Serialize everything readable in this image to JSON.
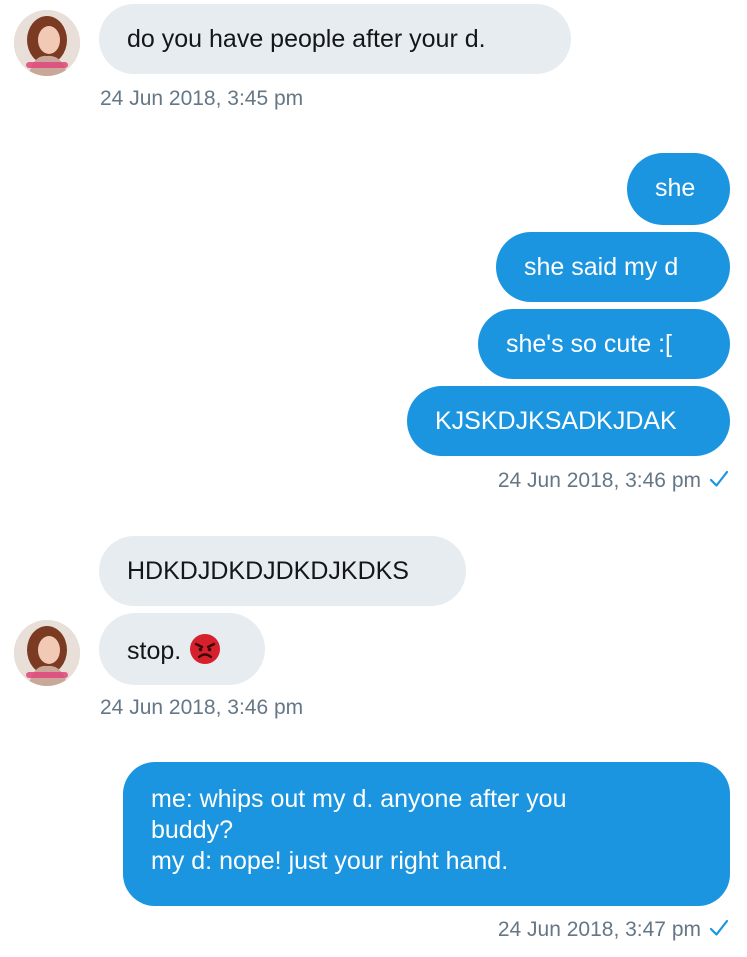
{
  "conversation": {
    "messages": [
      {
        "text": "do you have people after your d."
      },
      {
        "text": "she"
      },
      {
        "text": "she said my d"
      },
      {
        "text": "she's so cute :["
      },
      {
        "text": "KJSKDJKSADKJDAK"
      },
      {
        "text": "HDKDJDKDJDKDJKDKS"
      },
      {
        "text": "stop.",
        "emoji": "angry-face-icon"
      },
      {
        "lines": [
          "me: whips out my d. anyone after you",
          "buddy?",
          "my d: nope! just your right hand."
        ]
      }
    ],
    "timestamps": [
      "24 Jun 2018, 3:45 pm",
      "24 Jun 2018, 3:46 pm",
      "24 Jun 2018, 3:46 pm",
      "24 Jun 2018, 3:47 pm"
    ],
    "colors": {
      "outgoing_bubble": "#1b95e0",
      "incoming_bubble": "#e6ecf0",
      "timestamp": "#657786",
      "read_check": "#1b95e0"
    }
  }
}
